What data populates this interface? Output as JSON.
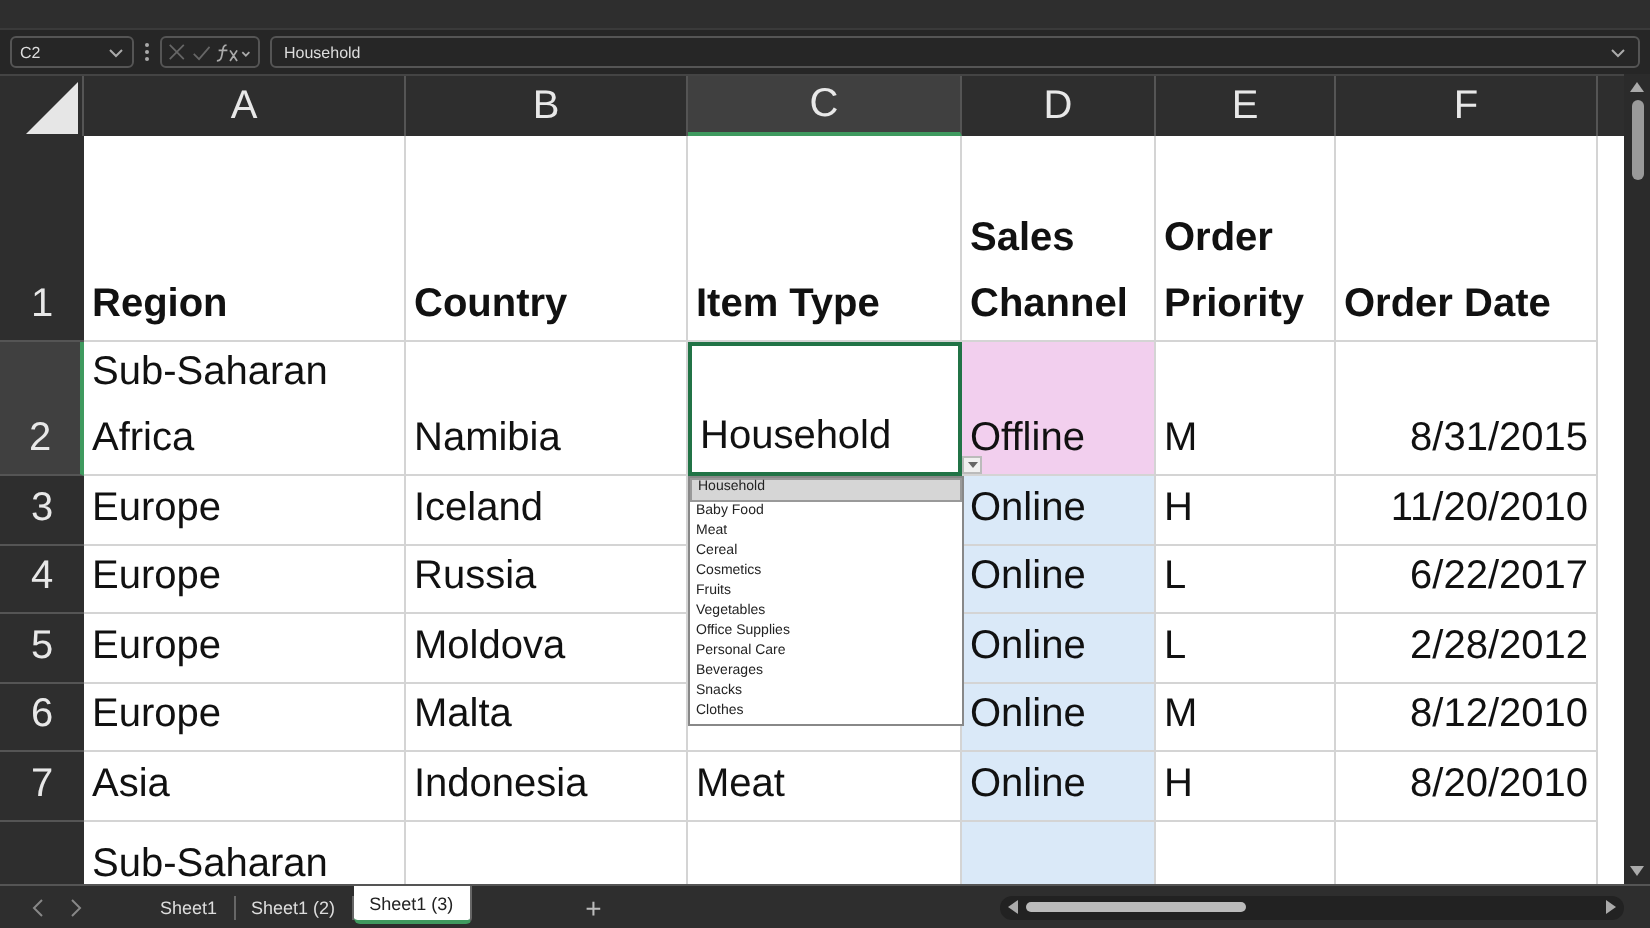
{
  "formula_bar": {
    "name_box": "C2",
    "formula": "Household"
  },
  "columns": [
    {
      "label": "A",
      "selected": false
    },
    {
      "label": "B",
      "selected": false
    },
    {
      "label": "C",
      "selected": true
    },
    {
      "label": "D",
      "selected": false
    },
    {
      "label": "E",
      "selected": false
    },
    {
      "label": "F",
      "selected": false
    }
  ],
  "rows": [
    {
      "header": "1",
      "selected": false,
      "cells": [
        {
          "text": "Region",
          "kind": "heading"
        },
        {
          "text": "Country",
          "kind": "heading"
        },
        {
          "text": "Item Type",
          "kind": "heading"
        },
        {
          "text": "Sales Channel",
          "kind": "heading"
        },
        {
          "text": "Order Priority",
          "kind": "heading"
        },
        {
          "text": "Order Date",
          "kind": "heading"
        }
      ]
    },
    {
      "header": "2",
      "selected": true,
      "cells": [
        {
          "text": "Sub-Saharan Africa",
          "kind": "text"
        },
        {
          "text": "Namibia",
          "kind": "text"
        },
        {
          "text": "Household",
          "kind": "text",
          "active": true
        },
        {
          "text": "Offline",
          "kind": "text",
          "color": "#f2cfee"
        },
        {
          "text": "M",
          "kind": "text"
        },
        {
          "text": "8/31/2015",
          "kind": "date"
        }
      ]
    },
    {
      "header": "3",
      "selected": false,
      "cells": [
        {
          "text": "Europe",
          "kind": "text"
        },
        {
          "text": "Iceland",
          "kind": "text"
        },
        {},
        {
          "text": "Online",
          "kind": "text",
          "color": "#dae9f8"
        },
        {
          "text": "H",
          "kind": "text"
        },
        {
          "text": "11/20/2010",
          "kind": "date"
        }
      ]
    },
    {
      "header": "4",
      "selected": false,
      "cells": [
        {
          "text": "Europe",
          "kind": "text"
        },
        {
          "text": "Russia",
          "kind": "text"
        },
        {},
        {
          "text": "Online",
          "kind": "text",
          "color": "#dae9f8"
        },
        {
          "text": "L",
          "kind": "text"
        },
        {
          "text": "6/22/2017",
          "kind": "date"
        }
      ]
    },
    {
      "header": "5",
      "selected": false,
      "cells": [
        {
          "text": "Europe",
          "kind": "text"
        },
        {
          "text": "Moldova",
          "kind": "text"
        },
        {},
        {
          "text": "Online",
          "kind": "text",
          "color": "#dae9f8"
        },
        {
          "text": "L",
          "kind": "text"
        },
        {
          "text": "2/28/2012",
          "kind": "date"
        }
      ]
    },
    {
      "header": "6",
      "selected": false,
      "cells": [
        {
          "text": "Europe",
          "kind": "text"
        },
        {
          "text": "Malta",
          "kind": "text"
        },
        {},
        {
          "text": "Online",
          "kind": "text",
          "color": "#dae9f8"
        },
        {
          "text": "M",
          "kind": "text"
        },
        {
          "text": "8/12/2010",
          "kind": "date"
        }
      ]
    },
    {
      "header": "7",
      "selected": false,
      "cells": [
        {
          "text": "Asia",
          "kind": "text"
        },
        {
          "text": "Indonesia",
          "kind": "text"
        },
        {
          "text": "Meat",
          "kind": "text"
        },
        {
          "text": "Online",
          "kind": "text",
          "color": "#dae9f8"
        },
        {
          "text": "H",
          "kind": "text"
        },
        {
          "text": "8/20/2010",
          "kind": "date"
        }
      ]
    },
    {
      "header": "",
      "selected": false,
      "cells": [
        {
          "text": "Sub-Saharan",
          "kind": "text"
        },
        {},
        {},
        {
          "kind": "text",
          "color": "#dae9f8"
        },
        {},
        {}
      ]
    }
  ],
  "dropdown": [
    {
      "label": "Household",
      "selected": true
    },
    {
      "label": "Baby Food",
      "selected": false
    },
    {
      "label": "Meat",
      "selected": false
    },
    {
      "label": "Cereal",
      "selected": false
    },
    {
      "label": "Cosmetics",
      "selected": false
    },
    {
      "label": "Fruits",
      "selected": false
    },
    {
      "label": "Vegetables",
      "selected": false
    },
    {
      "label": "Office Supplies",
      "selected": false
    },
    {
      "label": "Personal Care",
      "selected": false
    },
    {
      "label": "Beverages",
      "selected": false
    },
    {
      "label": "Snacks",
      "selected": false
    },
    {
      "label": "Clothes",
      "selected": false
    }
  ],
  "sheet_tabs": [
    {
      "label": "Sheet1",
      "selected": false
    },
    {
      "label": "Sheet1 (2)",
      "selected": false
    },
    {
      "label": "Sheet1 (3)",
      "selected": true
    }
  ],
  "add_sheet": "+"
}
